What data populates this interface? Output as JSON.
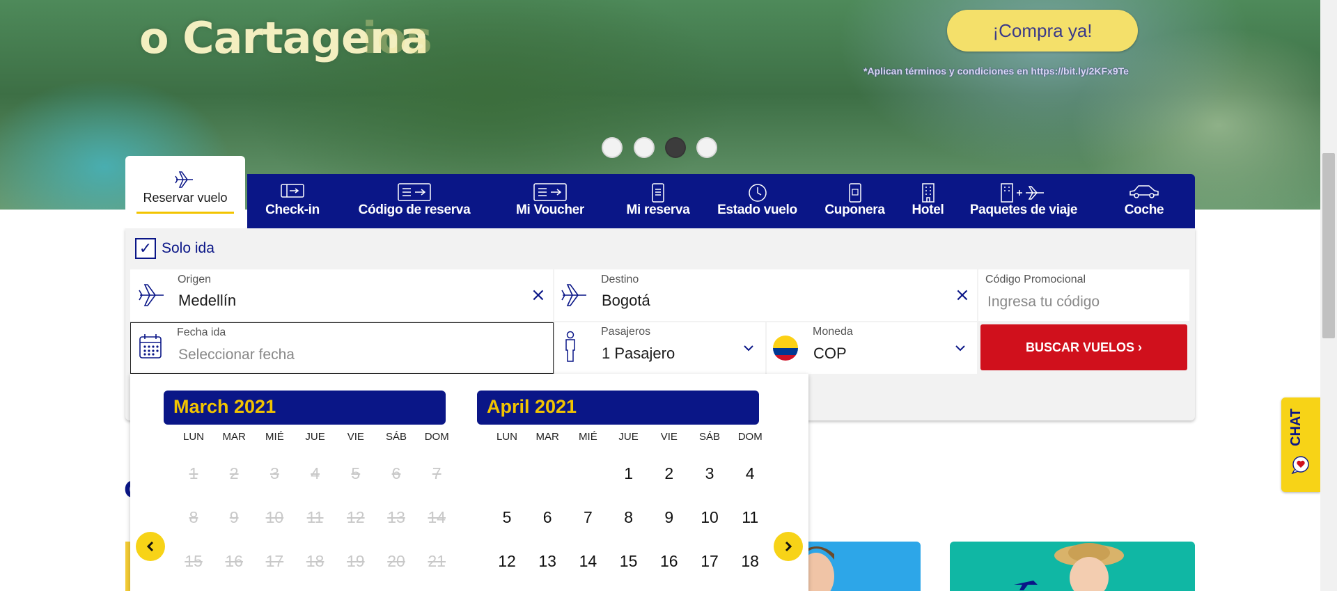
{
  "hero": {
    "title": "o Cartagena",
    "title_ghost": "ios",
    "cta_label": "¡Compra ya!",
    "terms": "*Aplican términos y condiciones en https://bit.ly/2KFx9Te",
    "carousel": {
      "slides": 4,
      "active_index": 2
    }
  },
  "tabs": {
    "active": {
      "label": "Reservar vuelo",
      "icon": "plane-icon"
    },
    "items": [
      {
        "label": "Check-in",
        "icon": "boarding-pass-icon"
      },
      {
        "label": "Código de reserva",
        "icon": "ticket-icon"
      },
      {
        "label": "Mi Voucher",
        "icon": "voucher-icon"
      },
      {
        "label": "Mi reserva",
        "icon": "mobile-booking-icon"
      },
      {
        "label": "Estado vuelo",
        "icon": "clock-icon"
      },
      {
        "label": "Cuponera",
        "icon": "coupon-phone-icon"
      },
      {
        "label": "Hotel",
        "icon": "hotel-icon"
      },
      {
        "label": "Paquetes de viaje",
        "icon": "hotel-plus-plane-icon"
      },
      {
        "label": "Coche",
        "icon": "car-icon"
      }
    ]
  },
  "form": {
    "solo_ida": {
      "label": "Solo ida",
      "checked": true
    },
    "origen": {
      "label": "Origen",
      "value": "Medellín"
    },
    "destino": {
      "label": "Destino",
      "value": "Bogotá"
    },
    "promo": {
      "label": "Código Promocional",
      "placeholder": "Ingresa tu código"
    },
    "fecha": {
      "label": "Fecha ida",
      "placeholder": "Seleccionar fecha"
    },
    "pasajeros": {
      "label": "Pasajeros",
      "value": "1 Pasajero"
    },
    "moneda": {
      "label": "Moneda",
      "value": "COP"
    },
    "buscar_label": "BUSCAR VUELOS ›"
  },
  "calendar": {
    "weekdays": [
      "LUN",
      "MAR",
      "MIÉ",
      "JUE",
      "VIE",
      "SÁB",
      "DOM"
    ],
    "months": [
      {
        "title": "March 2021",
        "offset": 0,
        "days": [
          "1",
          "2",
          "3",
          "4",
          "5",
          "6",
          "7",
          "8",
          "9",
          "10",
          "11",
          "12",
          "13",
          "14",
          "15",
          "16",
          "17",
          "18",
          "19",
          "20",
          "21"
        ],
        "past_through": 21
      },
      {
        "title": "April 2021",
        "offset": 3,
        "days": [
          "1",
          "2",
          "3",
          "4",
          "5",
          "6",
          "7",
          "8",
          "9",
          "10",
          "11",
          "12",
          "13",
          "14",
          "15",
          "16",
          "17",
          "18"
        ],
        "past_through": 0
      }
    ]
  },
  "chat": {
    "label": "CHAT"
  },
  "colors": {
    "navy": "#0a1687",
    "yellow": "#f7d317",
    "red": "#d0101c"
  }
}
